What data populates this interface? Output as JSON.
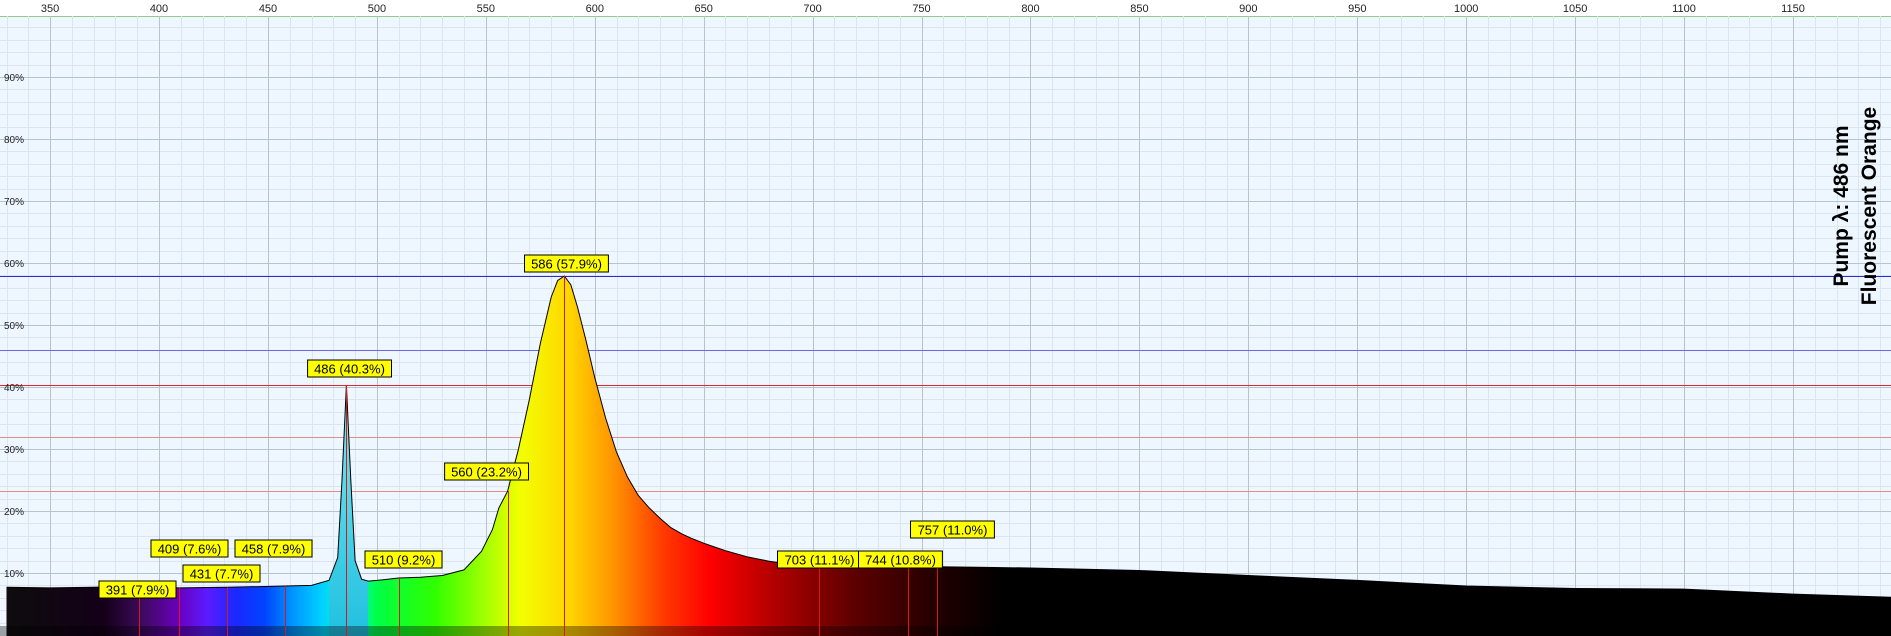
{
  "chart_data": {
    "type": "area",
    "subtitle": "Pump λ: 486 nm",
    "title": "Fluorescent Orange",
    "xlim": [
      327,
      1195
    ],
    "ylim": [
      0,
      100
    ],
    "x_ticks": [
      350,
      400,
      450,
      500,
      550,
      600,
      650,
      700,
      750,
      800,
      850,
      900,
      950,
      1000,
      1050,
      1100,
      1150
    ],
    "y_ticks": [
      {
        "value": 10,
        "label": "10%"
      },
      {
        "value": 20,
        "label": "20%"
      },
      {
        "value": 30,
        "label": "30%"
      },
      {
        "value": 40,
        "label": "40%"
      },
      {
        "value": 50,
        "label": "50%"
      },
      {
        "value": 60,
        "label": "60%"
      },
      {
        "value": 70,
        "label": "70%"
      },
      {
        "value": 80,
        "label": "80%"
      },
      {
        "value": 90,
        "label": "90%"
      }
    ],
    "grid": true,
    "series": [
      {
        "x": [
          330,
          350,
          370,
          391,
          409,
          431,
          458,
          470,
          478,
          482,
          484,
          486,
          488,
          490,
          493,
          496,
          500,
          510,
          520,
          530,
          540,
          548,
          553,
          556,
          560,
          565,
          570,
          575,
          580,
          583,
          586,
          589,
          592,
          596,
          600,
          605,
          610,
          615,
          620,
          625,
          630,
          635,
          640,
          645,
          650,
          655,
          660,
          670,
          680,
          690,
          703,
          720,
          744,
          757,
          780,
          800,
          850,
          900,
          950,
          1000,
          1050,
          1100,
          1150,
          1195
        ],
        "y": [
          7.7,
          7.6,
          7.7,
          7.9,
          7.6,
          7.7,
          7.9,
          8.0,
          8.8,
          12.5,
          25,
          40.3,
          25,
          12,
          9.0,
          8.7,
          8.8,
          9.2,
          9.3,
          9.6,
          10.5,
          13.5,
          17,
          20.5,
          23.2,
          30,
          38,
          47,
          54.5,
          57.2,
          57.9,
          56.5,
          53,
          47.5,
          41.5,
          35,
          29.5,
          25.5,
          22.5,
          20.5,
          18.8,
          17.3,
          16.3,
          15.5,
          14.8,
          14.2,
          13.6,
          12.6,
          11.9,
          11.4,
          11.1,
          10.9,
          10.8,
          11.0,
          10.9,
          10.8,
          10.4,
          9.6,
          8.8,
          7.9,
          7.5,
          7.4,
          6.6,
          6.1
        ]
      }
    ],
    "peaks": [
      {
        "label": "391 (7.9%)",
        "x": 391,
        "y": 7.9
      },
      {
        "label": "409 (7.6%)",
        "x": 409,
        "y": 7.6
      },
      {
        "label": "431 (7.7%)",
        "x": 431,
        "y": 7.7
      },
      {
        "label": "458 (7.9%)",
        "x": 458,
        "y": 7.9
      },
      {
        "label": "486 (40.3%)",
        "x": 486,
        "y": 40.3
      },
      {
        "label": "510 (9.2%)",
        "x": 510,
        "y": 9.2
      },
      {
        "label": "560 (23.2%)",
        "x": 560,
        "y": 23.2
      },
      {
        "label": "586 (57.9%)",
        "x": 586,
        "y": 57.9
      },
      {
        "label": "703 (11.1%)",
        "x": 703,
        "y": 11.1
      },
      {
        "label": "744 (10.8%)",
        "x": 744,
        "y": 10.8
      },
      {
        "label": "757 (11.0%)",
        "x": 757,
        "y": 11.0
      }
    ],
    "reference_lines": [
      {
        "y": 57.9,
        "color": "#2a2ad6"
      },
      {
        "y": 46.0,
        "color": "#6a6ae6"
      },
      {
        "y": 40.3,
        "color": "#e02828"
      },
      {
        "y": 32.0,
        "color": "#e88a8a"
      },
      {
        "y": 23.2,
        "color": "#e88a8a"
      }
    ],
    "colors": {
      "background": "#eef6ff",
      "grid_minor": "#dbe5ef",
      "grid_major": "#b7c3cf",
      "curve_outline": "#000000",
      "label_fill": "#ffff00",
      "peak_marker": "#d81818"
    }
  }
}
